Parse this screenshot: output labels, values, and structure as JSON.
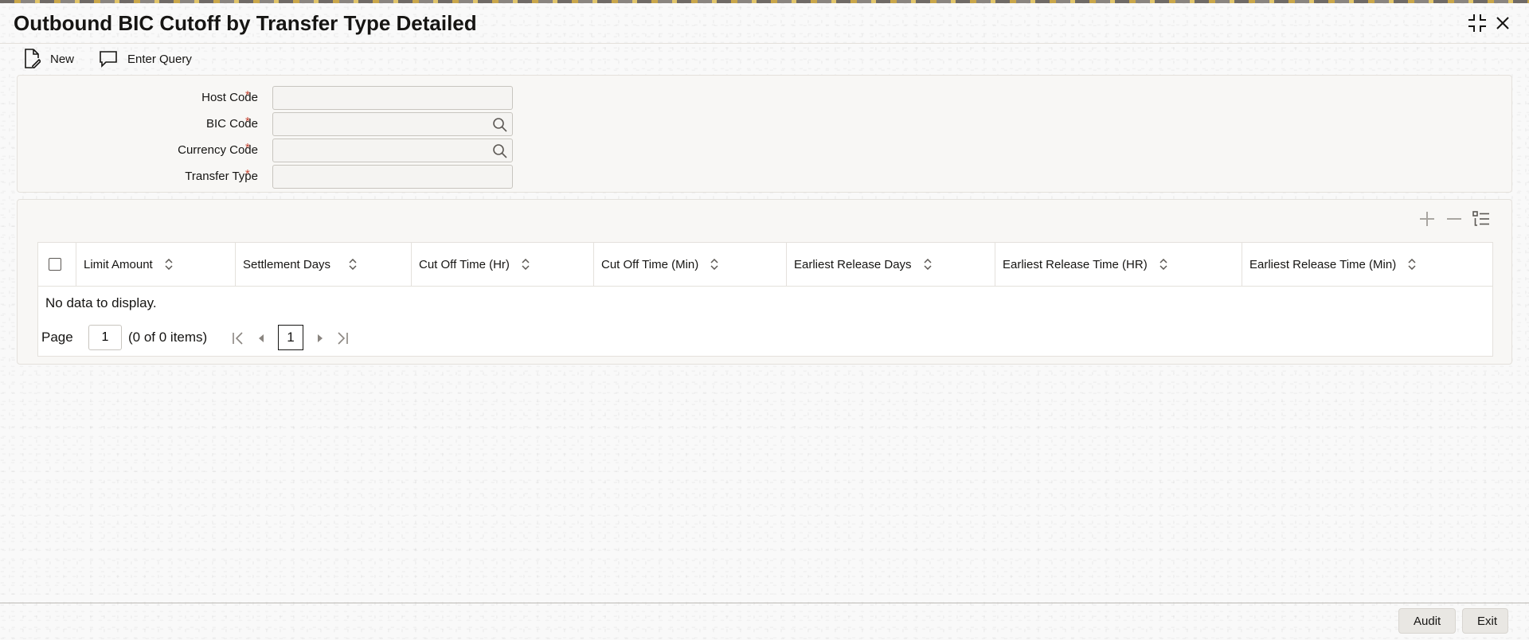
{
  "window": {
    "title": "Outbound BIC Cutoff by Transfer Type Detailed"
  },
  "toolbar": {
    "new_label": "New",
    "enter_query_label": "Enter Query"
  },
  "form": {
    "host_code_label": "Host Code",
    "host_code_value": "",
    "bic_code_label": "BIC Code",
    "bic_code_value": "",
    "currency_code_label": "Currency Code",
    "currency_code_value": "",
    "transfer_type_label": "Transfer Type",
    "transfer_type_value": "",
    "required_marker": "*"
  },
  "grid": {
    "columns": [
      "Limit Amount",
      "Settlement Days",
      "Cut Off Time (Hr)",
      "Cut Off Time (Min)",
      "Earliest Release Days",
      "Earliest Release Time (HR)",
      "Earliest Release Time (Min)"
    ],
    "empty_message": "No data to display.",
    "pager": {
      "page_label": "Page",
      "page_value": "1",
      "item_count": "(0 of 0 items)",
      "current_page": "1"
    }
  },
  "footer": {
    "audit_label": "Audit",
    "exit_label": "Exit"
  },
  "colors": {
    "required": "#c74634",
    "panel": "#f8f7f5",
    "border": "#e4e1dc"
  }
}
